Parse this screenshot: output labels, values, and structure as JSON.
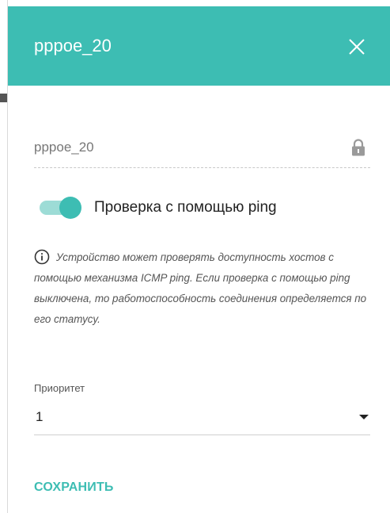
{
  "header": {
    "title": "pppoe_20"
  },
  "name_field": {
    "value": "pppoe_20"
  },
  "ping_toggle": {
    "label": "Проверка с помощью ping",
    "state": "on"
  },
  "info": {
    "text": "Устройство может проверять доступность хостов с помощью механизма ICMP ping. Если проверка с помощью ping выключена, то работоспособность соединения определяется по его статусу."
  },
  "priority": {
    "label": "Приоритет",
    "value": "1"
  },
  "actions": {
    "save_label": "СОХРАНИТЬ"
  },
  "colors": {
    "accent": "#3dbdb3",
    "accent_light": "#9ddcd6"
  },
  "icons": {
    "close": "close-icon",
    "lock": "lock-icon",
    "info": "info-icon",
    "dropdown": "caret-down-icon"
  }
}
